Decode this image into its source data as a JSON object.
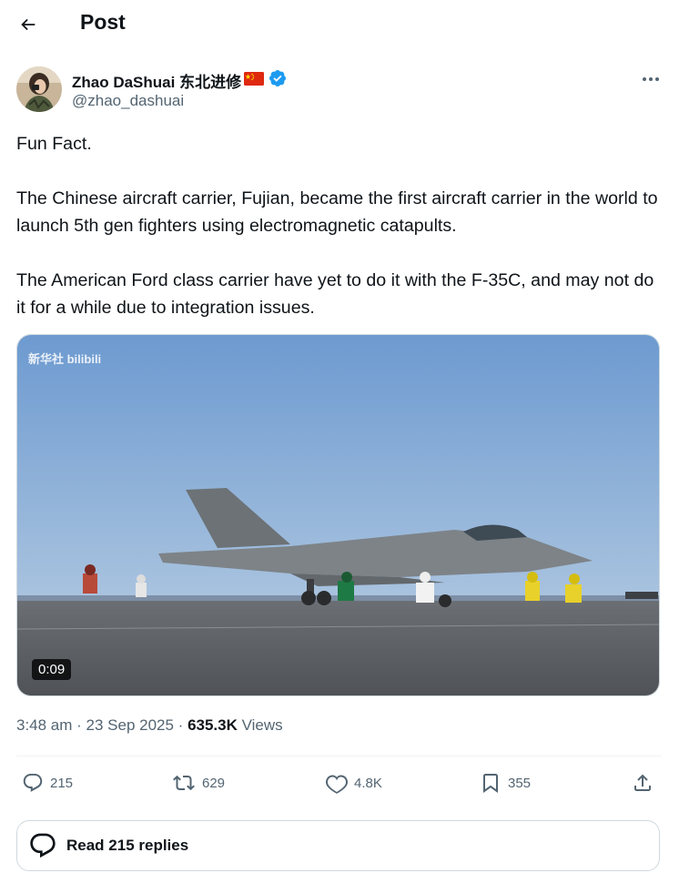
{
  "header": {
    "title": "Post",
    "back_icon": "arrow-left-icon"
  },
  "tweet": {
    "author_name": "Zhao DaShuai 东北进修",
    "author_flag": "china-flag-icon",
    "verified_icon": "verified-badge-icon",
    "handle": "@zhao_dashuai",
    "more_icon": "more-horizontal-icon",
    "text": [
      "Fun Fact.",
      "The Chinese aircraft carrier, Fujian, became the first aircraft carrier in the world to launch 5th gen fighters using electromagnetic catapults.",
      "The American Ford class carrier have yet to do it with the F-35C, and may not do it for a while due to integration issues."
    ],
    "media": {
      "watermark": "新华社 bilibili",
      "duration": "0:09"
    },
    "timestamp": "3:48 am · 23 Sep 2025 · ",
    "views_count": "635.3K",
    "views_label": " Views"
  },
  "actions": {
    "replies": "215",
    "reposts": "629",
    "likes": "4.8K",
    "bookmarks": "355"
  },
  "read_replies": "Read 215 replies",
  "colors": {
    "accent": "#1d9bf0",
    "text": "#0f1419",
    "muted": "#536471",
    "border": "#cfd9de"
  }
}
